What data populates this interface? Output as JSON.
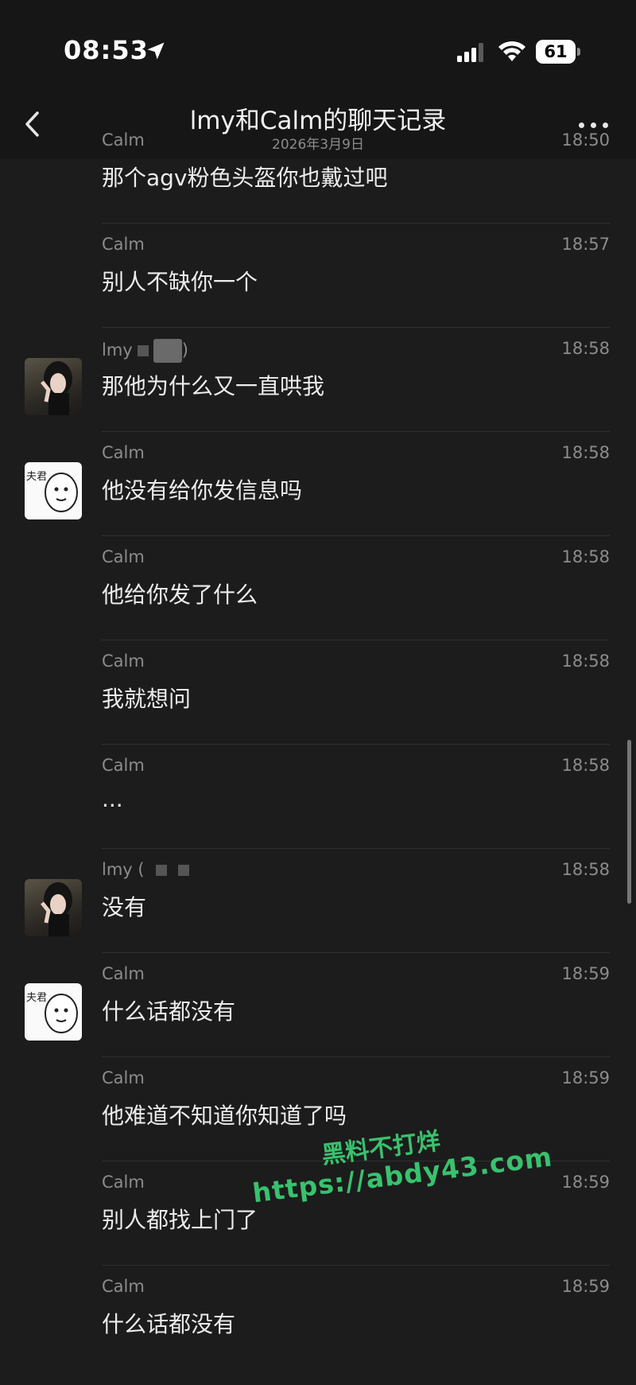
{
  "status_bar": {
    "time": "08:53",
    "battery": "61",
    "location_icon": "location-arrow-icon",
    "signal_icon": "cell-signal-icon",
    "wifi_icon": "wifi-icon"
  },
  "header": {
    "title": "lmy和Calm的聊天记录",
    "subtitle": "2026年3月9日",
    "back_icon": "chevron-left-icon",
    "more_icon": "more-dots-icon"
  },
  "messages": [
    {
      "sender": "Calm",
      "time": "18:50",
      "text": "那个agv粉色头盔你也戴过吧",
      "avatar": ""
    },
    {
      "sender": "Calm",
      "time": "18:57",
      "text": "别人不缺你一个",
      "avatar": ""
    },
    {
      "sender": "lmy",
      "sender_suffix": ")",
      "time": "18:58",
      "text": "那他为什么又一直哄我",
      "avatar": "girl"
    },
    {
      "sender": "Calm",
      "time": "18:58",
      "text": "他没有给你发信息吗",
      "avatar": "sticker"
    },
    {
      "sender": "Calm",
      "time": "18:58",
      "text": "他给你发了什么",
      "avatar": ""
    },
    {
      "sender": "Calm",
      "time": "18:58",
      "text": "我就想问",
      "avatar": ""
    },
    {
      "sender": "Calm",
      "time": "18:58",
      "text": "...",
      "avatar": ""
    },
    {
      "sender": "lmy (",
      "time": "18:58",
      "text": "没有",
      "avatar": "girl"
    },
    {
      "sender": "Calm",
      "time": "18:59",
      "text": "什么话都没有",
      "avatar": "sticker"
    },
    {
      "sender": "Calm",
      "time": "18:59",
      "text": "他难道不知道你知道了吗",
      "avatar": ""
    },
    {
      "sender": "Calm",
      "time": "18:59",
      "text": "别人都找上门了",
      "avatar": ""
    },
    {
      "sender": "Calm",
      "time": "18:59",
      "text": "什么话都没有",
      "avatar": ""
    }
  ],
  "sticker_avatar_text": "夫君",
  "watermark": {
    "line1": "黑料不打烊",
    "line2": "https://abdy43.com"
  },
  "colors": {
    "background": "#1c1c1c",
    "header": "#161616",
    "watermark": "#38c26e"
  }
}
